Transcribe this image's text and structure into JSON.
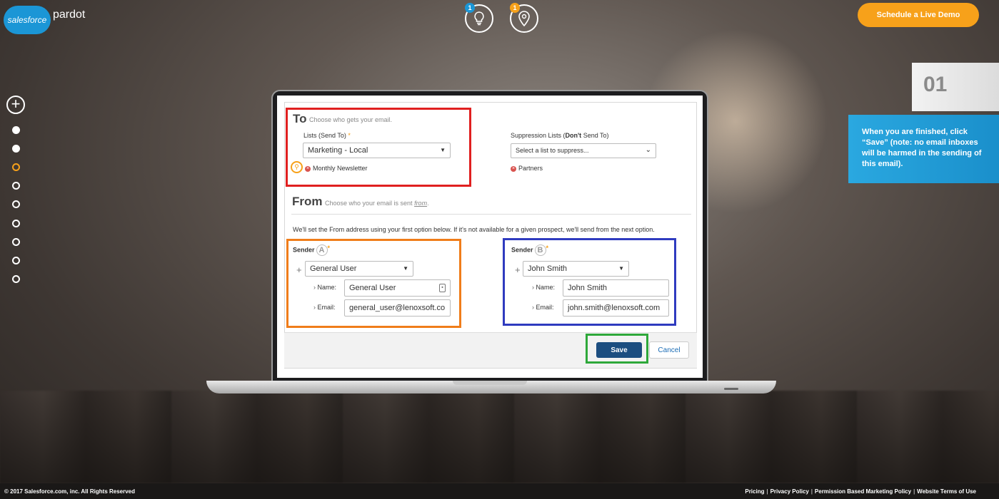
{
  "brand": {
    "cloud": "salesforce",
    "product": "pardot"
  },
  "top_icons": [
    {
      "name": "lightbulb",
      "badge": "1",
      "badge_color": "#1b96d6"
    },
    {
      "name": "map-pin",
      "badge": "1",
      "badge_color": "#f7a11a"
    }
  ],
  "demo_button": "Schedule a Live Demo",
  "progress": {
    "total_steps": 8,
    "current_step": 3
  },
  "step": {
    "number": "01",
    "tip": "When you are finished, click “Save” (note: no email inboxes will be harmed in the sending of this email)."
  },
  "form": {
    "to": {
      "title": "To",
      "subtitle": "Choose who gets your email.",
      "lists_label": "Lists (Send To)",
      "lists_selected": "Marketing - Local",
      "lists_chip": "Monthly Newsletter",
      "suppression_label_start": "Suppression Lists (",
      "suppression_label_bold": "Don't",
      "suppression_label_end": " Send To)",
      "suppression_placeholder": "Select a list to suppress...",
      "suppression_chip": "Partners"
    },
    "from": {
      "title": "From",
      "subtitle_start": "Choose who your email is sent ",
      "subtitle_em": "from",
      "subtitle_end": ".",
      "note": "We'll set the From address using your first option below. If it's not available for a given prospect, we'll send from the next option.",
      "sender_label": "Sender",
      "name_label": "Name:",
      "email_label": "Email:",
      "sender_a": {
        "letter": "A",
        "selected": "General User",
        "name": "General User",
        "email": "general_user@lenoxsoft.co"
      },
      "sender_b": {
        "letter": "B",
        "selected": "John Smith",
        "name": "John Smith",
        "email": "john.smith@lenoxsoft.com"
      }
    },
    "save": "Save",
    "cancel": "Cancel"
  },
  "highlight_colors": {
    "to": "#e02020",
    "sender_a": "#f07d1a",
    "sender_b": "#2f3bbf",
    "save": "#2ea83a"
  },
  "footer": {
    "copyright": "© 2017 Salesforce.com, inc. All Rights Reserved",
    "links": [
      "Pricing",
      "Privacy Policy",
      "Permission Based Marketing Policy",
      "Website Terms of Use"
    ]
  }
}
